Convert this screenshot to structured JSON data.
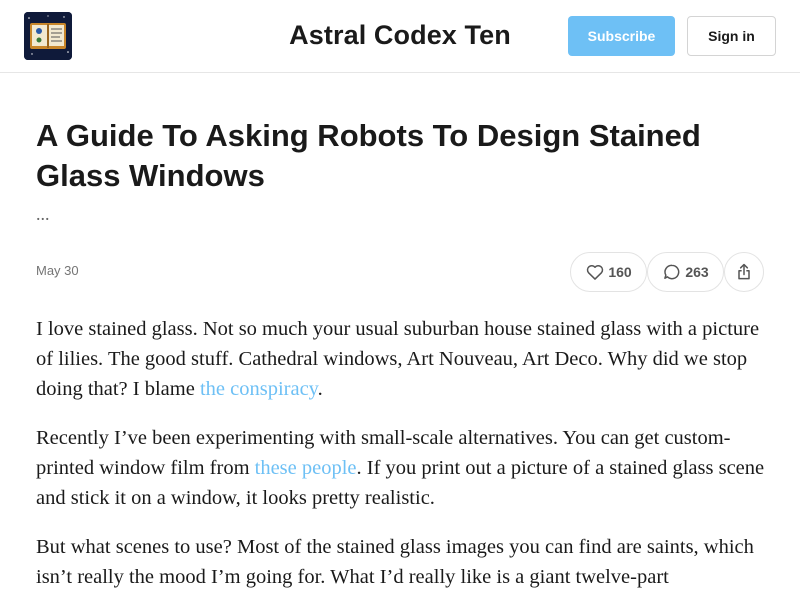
{
  "header": {
    "site_title": "Astral Codex Ten",
    "subscribe_label": "Subscribe",
    "signin_label": "Sign in",
    "logo_icon": "open-book-logo-icon"
  },
  "post": {
    "title": "A Guide To Asking Robots To Design Stained Glass Windows",
    "subtitle": "...",
    "date": "May 30",
    "likes": "160",
    "comments": "263",
    "like_icon": "heart-icon",
    "comment_icon": "comment-bubble-icon",
    "share_icon": "share-icon"
  },
  "body": {
    "p1": {
      "before": "I love stained glass. Not so much your usual suburban house stained glass with a picture of lilies. The good stuff. Cathedral windows, Art Nouveau, Art Deco. Why did we stop doing that? I blame ",
      "link": "the conspiracy",
      "after": "."
    },
    "p2": {
      "before": "Recently I’ve been experimenting with small-scale alternatives. You can get custom-printed window film from ",
      "link": "these people",
      "after": ". If you print out a picture of a stained glass scene and stick it on a window, it looks pretty realistic."
    },
    "p3": {
      "text": "But what scenes to use? Most of the stained glass images you can find are saints, which isn’t really the mood I’m going for. What I’d really like is a giant twelve-part"
    }
  },
  "colors": {
    "accent": "#6ec0f5",
    "text": "#1a1a1a",
    "muted": "#757575",
    "border": "#e3e3e3"
  }
}
